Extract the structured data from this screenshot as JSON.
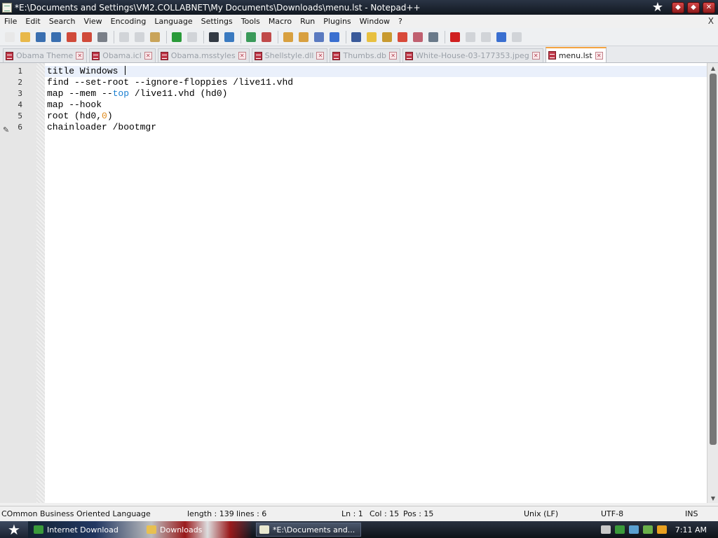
{
  "window": {
    "title": "*E:\\Documents and Settings\\VM2.COLLABNET\\My Documents\\Downloads\\menu.lst - Notepad++",
    "menu_close": "X"
  },
  "menu": [
    "File",
    "Edit",
    "Search",
    "View",
    "Encoding",
    "Language",
    "Settings",
    "Tools",
    "Macro",
    "Run",
    "Plugins",
    "Window",
    "?"
  ],
  "toolbar": [
    {
      "name": "new-file-icon",
      "color": "#e8e8e8",
      "disabled": false
    },
    {
      "name": "open-file-icon",
      "color": "#e8b84a",
      "disabled": false
    },
    {
      "name": "save-icon",
      "color": "#3a6fb0",
      "disabled": false
    },
    {
      "name": "save-all-icon",
      "color": "#3a6fb0",
      "disabled": false
    },
    {
      "name": "close-icon",
      "color": "#d04a3a",
      "disabled": false
    },
    {
      "name": "close-all-icon",
      "color": "#d04a3a",
      "disabled": false
    },
    {
      "name": "print-icon",
      "color": "#7a7f88",
      "disabled": false
    },
    {
      "sep": true
    },
    {
      "name": "cut-icon",
      "color": "#9aa0a8",
      "disabled": true
    },
    {
      "name": "copy-icon",
      "color": "#9aa0a8",
      "disabled": true
    },
    {
      "name": "paste-icon",
      "color": "#c9a45a",
      "disabled": false
    },
    {
      "sep": true
    },
    {
      "name": "undo-icon",
      "color": "#2a9a3a",
      "disabled": false
    },
    {
      "name": "redo-icon",
      "color": "#9aa0a8",
      "disabled": true
    },
    {
      "sep": true
    },
    {
      "name": "find-icon",
      "color": "#333a44",
      "disabled": false
    },
    {
      "name": "replace-icon",
      "color": "#3a7ac0",
      "disabled": false
    },
    {
      "sep": true
    },
    {
      "name": "zoom-in-icon",
      "color": "#3a9a5a",
      "disabled": false
    },
    {
      "name": "zoom-out-icon",
      "color": "#c04a4a",
      "disabled": false
    },
    {
      "sep": true
    },
    {
      "name": "sync-vertical-icon",
      "color": "#d8a040",
      "disabled": false
    },
    {
      "name": "sync-horizontal-icon",
      "color": "#d8a040",
      "disabled": false
    },
    {
      "name": "word-wrap-icon",
      "color": "#5a7ac0",
      "disabled": false
    },
    {
      "name": "show-all-chars-icon",
      "color": "#3a6fd0",
      "disabled": false
    },
    {
      "sep": true
    },
    {
      "name": "indent-guide-icon",
      "color": "#3a5a9a",
      "disabled": false
    },
    {
      "name": "user-language-icon",
      "color": "#e8c040",
      "disabled": false
    },
    {
      "name": "function-list-icon",
      "color": "#c89a30",
      "disabled": false
    },
    {
      "name": "doc-map-icon",
      "color": "#d84a3a",
      "disabled": false
    },
    {
      "name": "folder-workspace-icon",
      "color": "#c06070",
      "disabled": false
    },
    {
      "name": "monitor-icon",
      "color": "#6a7a8a",
      "disabled": false
    },
    {
      "sep": true
    },
    {
      "name": "record-macro-icon",
      "color": "#d02020",
      "disabled": false
    },
    {
      "name": "stop-record-icon",
      "color": "#9aa0a8",
      "disabled": true
    },
    {
      "name": "play-macro-icon",
      "color": "#9aa0a8",
      "disabled": true
    },
    {
      "name": "run-macro-multiple-icon",
      "color": "#3a6fd0",
      "disabled": false
    },
    {
      "name": "save-macro-icon",
      "color": "#9aa0a8",
      "disabled": true
    }
  ],
  "tabs": [
    {
      "label": "Obama Theme",
      "active": false
    },
    {
      "label": "Obama.icl",
      "active": false
    },
    {
      "label": "Obama.msstyles",
      "active": false
    },
    {
      "label": "Shellstyle.dll",
      "active": false
    },
    {
      "label": "Thumbs.db",
      "active": false
    },
    {
      "label": "White-House-03-177353.jpeg",
      "active": false
    },
    {
      "label": "menu.lst",
      "active": true
    }
  ],
  "tab_close_glyph": "✕",
  "editor": {
    "line_numbers": [
      "1",
      "2",
      "3",
      "4",
      "5",
      "6"
    ],
    "lines": [
      [
        {
          "t": "title Windows "
        }
      ],
      [
        {
          "t": "find --set-root --ignore-floppies /live11.vhd"
        }
      ],
      [
        {
          "t": "map --mem --"
        },
        {
          "t": "top",
          "c": "kw"
        },
        {
          "t": " /live11.vhd (hd0)"
        }
      ],
      [
        {
          "t": "map --hook"
        }
      ],
      [
        {
          "t": "root (hd0,"
        },
        {
          "t": "0",
          "c": "num"
        },
        {
          "t": ")"
        }
      ],
      [
        {
          "t": "chainloader /bootmgr"
        }
      ]
    ],
    "caret_line": 0
  },
  "status": {
    "language": "COmmon Business Oriented Language",
    "length": "length : 139",
    "lines": "lines : 6",
    "ln": "Ln : 1",
    "col": "Col : 15",
    "pos": "Pos : 15",
    "eol": "Unix (LF)",
    "encoding": "UTF-8",
    "mode": "INS"
  },
  "taskbar": {
    "items": [
      {
        "label": "Internet Download",
        "icon": "#3a9a3a",
        "active": false,
        "name": "taskbar-item-internet-download"
      },
      {
        "label": "Downloads",
        "icon": "#e8c050",
        "active": false,
        "name": "taskbar-item-downloads"
      },
      {
        "label": "*E:\\Documents and...",
        "icon": "#e8e8d0",
        "active": true,
        "name": "taskbar-item-notepad"
      }
    ],
    "clock": "7:11 AM"
  }
}
